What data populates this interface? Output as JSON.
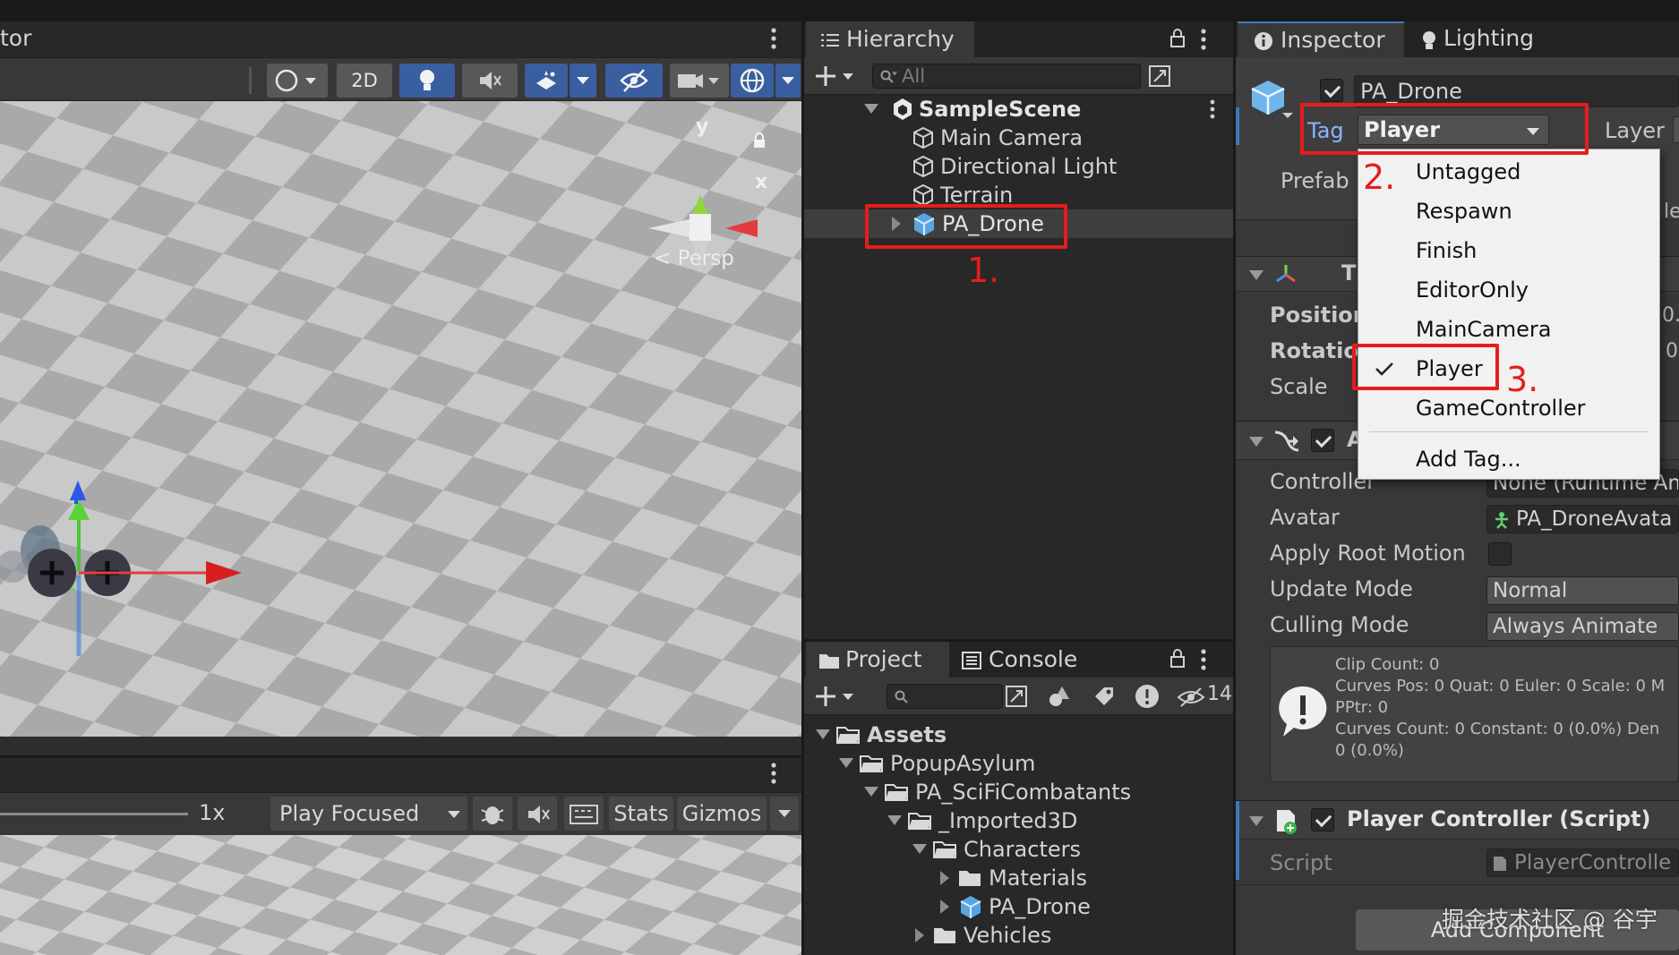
{
  "scene": {
    "tab_title": "tor",
    "toolbar": {
      "mode_2d": "2D"
    },
    "gizmo": {
      "axis_y": "y",
      "axis_x": "x",
      "projection": "< Persp"
    }
  },
  "game": {
    "scale_label": "1x",
    "play_mode": "Play Focused",
    "stats": "Stats",
    "gizmos": "Gizmos"
  },
  "hierarchy": {
    "tab_title": "Hierarchy",
    "search_placeholder": "All",
    "scene_name": "SampleScene",
    "items": [
      "Main Camera",
      "Directional Light",
      "Terrain",
      "PA_Drone"
    ]
  },
  "project": {
    "tabs": [
      "Project",
      "Console"
    ],
    "badge_count": "14",
    "tree": [
      "Assets",
      "PopupAsylum",
      "PA_SciFiCombatants",
      "_Imported3D",
      "Characters",
      "Materials",
      "PA_Drone",
      "Vehicles"
    ]
  },
  "inspector": {
    "tabs": [
      "Inspector",
      "Lighting"
    ],
    "object_name": "PA_Drone",
    "tag_label": "Tag",
    "tag_value": "Player",
    "layer_label": "Layer",
    "prefab_label": "Prefab",
    "transform": {
      "header_letter": "T",
      "position_label": "Position",
      "rotation_label": "Rotatio",
      "scale_label": "Scale",
      "position_tail": "0.:",
      "rotation_tail": "0",
      "prefab_tail": "le"
    },
    "animator": {
      "header_letter": "A",
      "controller_label": "Controller",
      "controller_value": "None (Runtime An",
      "avatar_label": "Avatar",
      "avatar_value": "PA_DroneAvata",
      "apply_root_motion_label": "Apply Root Motion",
      "update_mode_label": "Update Mode",
      "update_mode_value": "Normal",
      "culling_mode_label": "Culling Mode",
      "culling_mode_value": "Always Animate",
      "info_lines": [
        "Clip Count: 0",
        "Curves Pos: 0 Quat: 0 Euler: 0 Scale: 0 M",
        "PPtr: 0",
        "Curves Count: 0 Constant: 0 (0.0%) Den",
        "0 (0.0%)"
      ]
    },
    "player_controller": {
      "header": "Player Controller (Script)",
      "script_label": "Script",
      "script_value": "PlayerControlle"
    },
    "add_component": "Add Component"
  },
  "tag_dropdown": {
    "items": [
      "Untagged",
      "Respawn",
      "Finish",
      "EditorOnly",
      "MainCamera",
      "Player",
      "GameController",
      "Add Tag..."
    ],
    "selected": "Player"
  },
  "annotations": {
    "step1": "1.",
    "step2": "2.",
    "step3": "3.",
    "color": "#e51d1d"
  },
  "watermark": "掘金技术社区 @ 谷宇",
  "colors": {
    "panel_bg": "#383838",
    "dark_bg": "#282828",
    "accent_blue": "#3a5fa0",
    "selection": "#3e3e3e"
  }
}
